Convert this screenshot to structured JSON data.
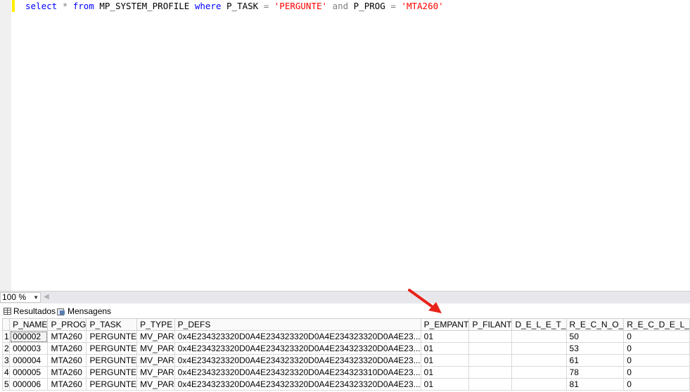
{
  "editor": {
    "query_tokens": [
      {
        "t": "select",
        "c": "kw"
      },
      {
        "t": " ",
        "c": "id"
      },
      {
        "t": "*",
        "c": "gray"
      },
      {
        "t": " ",
        "c": "id"
      },
      {
        "t": "from",
        "c": "kw"
      },
      {
        "t": " MP_SYSTEM_PROFILE ",
        "c": "id"
      },
      {
        "t": "where",
        "c": "kw"
      },
      {
        "t": " P_TASK ",
        "c": "id"
      },
      {
        "t": "=",
        "c": "gray"
      },
      {
        "t": " ",
        "c": "id"
      },
      {
        "t": "'PERGUNTE'",
        "c": "str"
      },
      {
        "t": " ",
        "c": "id"
      },
      {
        "t": "and",
        "c": "gray"
      },
      {
        "t": " P_PROG ",
        "c": "id"
      },
      {
        "t": "=",
        "c": "gray"
      },
      {
        "t": " ",
        "c": "id"
      },
      {
        "t": "'MTA260'",
        "c": "str"
      }
    ]
  },
  "zoom": {
    "value": "100 %"
  },
  "tabs": {
    "results": "Resultados",
    "messages": "Mensagens"
  },
  "grid": {
    "columns": [
      "",
      "P_NAME",
      "P_PROG",
      "P_TASK",
      "P_TYPE",
      "P_DEFS",
      "P_EMPANT",
      "P_FILANT",
      "D_E_L_E_T_",
      "R_E_C_N_O_",
      "R_E_C_D_E_L_"
    ],
    "rows": [
      [
        "1",
        "000002",
        "MTA260",
        "PERGUNTE",
        "MV_PAR",
        "0x4E234323320D0A4E234323320D0A4E234323320D0A4E23...",
        "01",
        "",
        "",
        "50",
        "0"
      ],
      [
        "2",
        "000003",
        "MTA260",
        "PERGUNTE",
        "MV_PAR",
        "0x4E234323320D0A4E234323320D0A4E234323320D0A4E23...",
        "01",
        "",
        "",
        "53",
        "0"
      ],
      [
        "3",
        "000004",
        "MTA260",
        "PERGUNTE",
        "MV_PAR",
        "0x4E234323320D0A4E234323320D0A4E234323320D0A4E23...",
        "01",
        "",
        "",
        "61",
        "0"
      ],
      [
        "4",
        "000005",
        "MTA260",
        "PERGUNTE",
        "MV_PAR",
        "0x4E234323320D0A4E234323320D0A4E234323310D0A4E23...",
        "01",
        "",
        "",
        "78",
        "0"
      ],
      [
        "5",
        "000006",
        "MTA260",
        "PERGUNTE",
        "MV_PAR",
        "0x4E234323320D0A4E234323320D0A4E234323320D0A4E23...",
        "01",
        "",
        "",
        "81",
        "0"
      ]
    ]
  },
  "annotation": {
    "arrow_color": "#e8231a"
  }
}
